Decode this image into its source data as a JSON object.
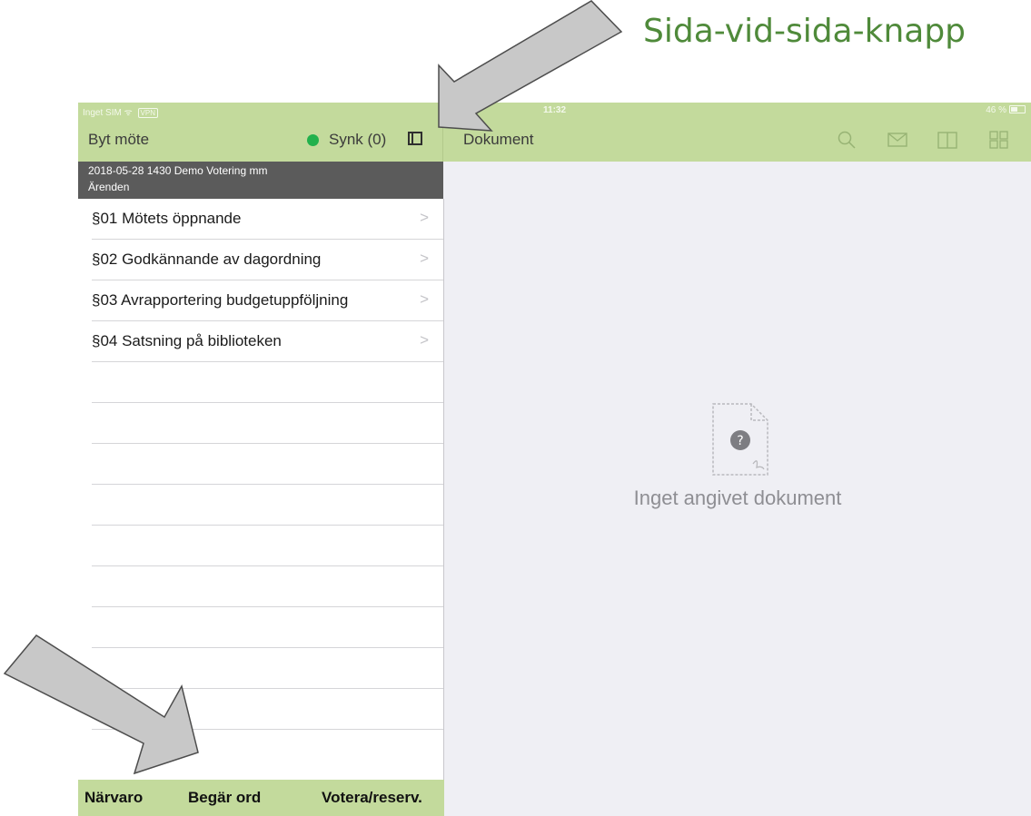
{
  "annotation": {
    "caption": "Sida-vid-sida-knapp"
  },
  "status_bar": {
    "carrier": "Inget SIM",
    "wifi_glyph": "ᯤ",
    "vpn": "VPN",
    "time": "11:32",
    "battery": "46 %"
  },
  "nav": {
    "back_label": "Byt möte",
    "sync_label": "Synk (0)",
    "sync_color": "#22b14c",
    "document_title": "Dokument",
    "icons": [
      "sidebar-toggle-icon",
      "search-icon",
      "mail-icon",
      "book-icon",
      "grid-icon"
    ]
  },
  "meeting": {
    "line1": "2018-05-28 1430  Demo Votering mm",
    "line2": "Ärenden"
  },
  "items": [
    {
      "label": "§01 Mötets öppnande",
      "chevron": ">"
    },
    {
      "label": "§02 Godkännande av dagordning",
      "chevron": ">"
    },
    {
      "label": "§03 Avrapportering budgetuppföljning",
      "chevron": ">"
    },
    {
      "label": "§04 Satsning på biblioteken",
      "chevron": ">"
    }
  ],
  "toolbar": {
    "attendance": "Närvaro",
    "request_floor": "Begär ord",
    "vote": "Votera/reserv."
  },
  "empty_state": {
    "placeholder_glyph": "?",
    "message": "Inget angivet dokument"
  },
  "colors": {
    "bar_green": "#c3da9c",
    "caption_green": "#4f8a3a",
    "header_gray": "#5b5b5b",
    "arrow_gray": "#c8c8c8"
  }
}
